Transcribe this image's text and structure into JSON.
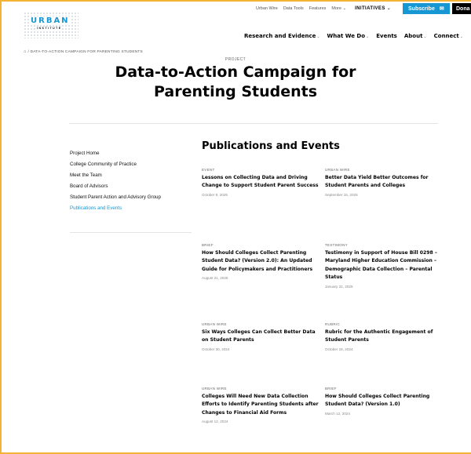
{
  "header": {
    "logo_text": "URBAN",
    "logo_subtext": "INSTITUTE",
    "util_nav": [
      "Urban Wire",
      "Data Tools",
      "Features",
      "More"
    ],
    "initiatives": "INITIATIVES",
    "subscribe": "Subscribe",
    "donate": "Dona",
    "main_nav": [
      "Research and Evidence",
      "What We Do",
      "Events",
      "About",
      "Connect"
    ]
  },
  "breadcrumb": "/ DATA-TO-ACTION CAMPAIGN FOR PARENTING STUDENTS",
  "project_label": "PROJECT",
  "page_title": "Data-to-Action Campaign for Parenting Students",
  "sidebar": {
    "items": [
      "Project Home",
      "College Community of Practice",
      "Meet the Team",
      "Board of Advisors",
      "Student Parent Action and Advisory Group",
      "Publications and Events"
    ],
    "active_index": 5
  },
  "section_title": "Publications and Events",
  "publications": [
    {
      "type": "EVENT",
      "title": "Lessons on Collecting Data and Driving Change to Support Student Parent Success",
      "date": "October 9, 2025"
    },
    {
      "type": "URBAN WIRE",
      "title": "Better Data Yield Better Outcomes for Student Parents and Colleges",
      "date": "September 15, 2025"
    },
    {
      "type": "BRIEF",
      "title": "How Should Colleges Collect Parenting Student Data? (Version 2.0): An Updated Guide for Policymakers and Practitioners",
      "date": "August 21, 2025"
    },
    {
      "type": "TESTIMONY",
      "title": "Testimony in Support of House Bill 0298 – Maryland Higher Education Commission – Demographic Data Collection – Parental Status",
      "date": "January 31, 2025"
    },
    {
      "type": "URBAN WIRE",
      "title": "Six Ways Colleges Can Collect Better Data on Student Parents",
      "date": "October 30, 2024"
    },
    {
      "type": "RUBRIC",
      "title": "Rubric for the Authentic Engagement of Student Parents",
      "date": "October 18, 2024"
    },
    {
      "type": "URBAN WIRE",
      "title": "Colleges Will Need New Data Collection Efforts to Identify Parenting Students after Changes to Financial Aid Forms",
      "date": "August 12, 2024"
    },
    {
      "type": "BRIEF",
      "title": "How Should Colleges Collect Parenting Student Data? (Version 1.0)",
      "date": "March 12, 2024"
    }
  ],
  "colors": {
    "accent": "#1696d2",
    "frame": "#f5b335"
  }
}
